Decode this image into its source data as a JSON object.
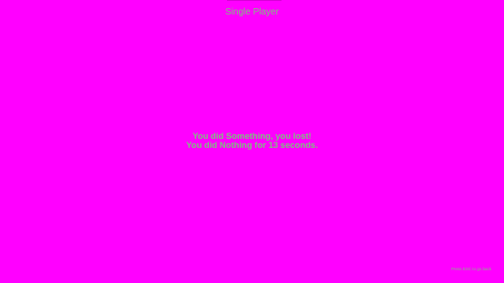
{
  "screen": {
    "background_color": "#ff00ff",
    "text_color": "#7fbf7f"
  },
  "header": {
    "mode_title": "Single Player"
  },
  "result": {
    "line1": "You did Something, you lost!",
    "line2": "You did Nothing for 13 seconds."
  },
  "footer": {
    "back_hint": "Press ESC to go back"
  }
}
